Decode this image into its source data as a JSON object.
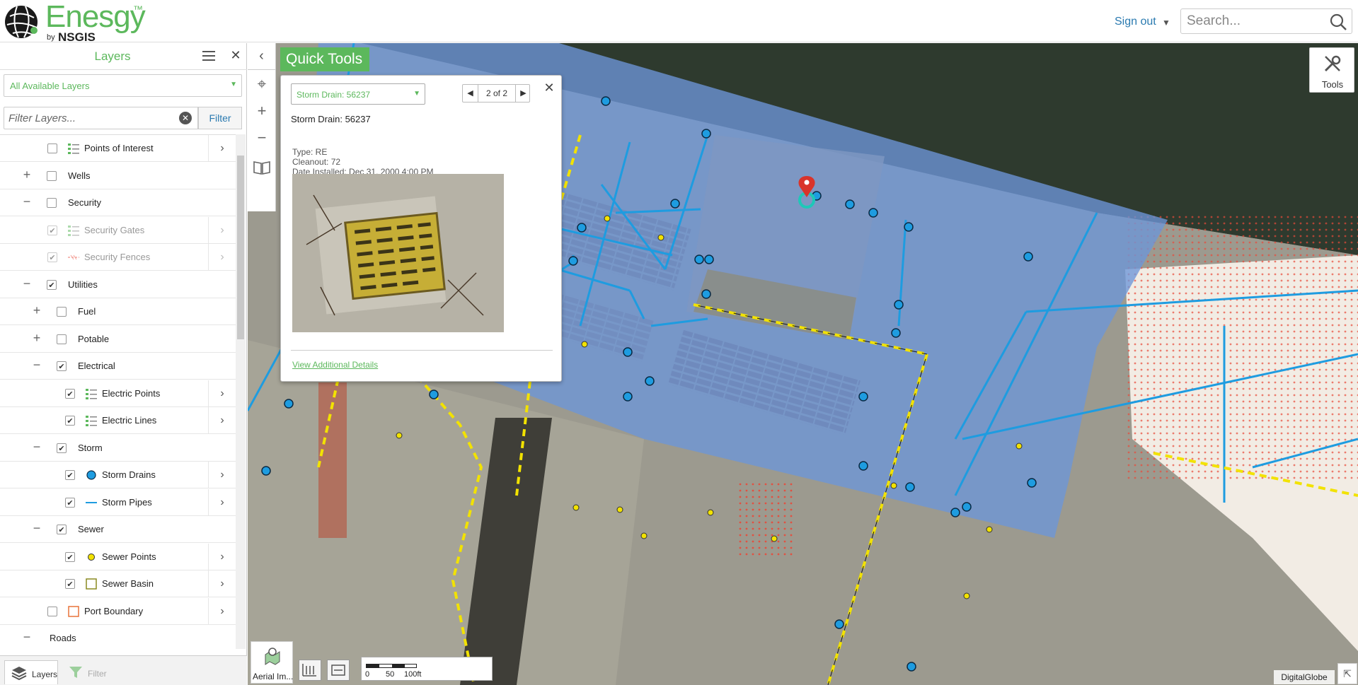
{
  "header": {
    "brand": "Enesgy",
    "trademark": "™",
    "by": "by",
    "company": "NSGIS",
    "sign_out": "Sign out",
    "search_placeholder": "Search..."
  },
  "sidebar": {
    "title": "Layers",
    "layer_select": "All Available Layers",
    "filter_placeholder": "Filter Layers...",
    "filter_button": "Filter",
    "tree": [
      {
        "label": "Points of Interest",
        "checked": false,
        "expander": "",
        "symbol": "legend-list",
        "sub": true
      },
      {
        "label": "Wells",
        "checked": false,
        "expander": "+",
        "symbol": "",
        "sub": false
      },
      {
        "label": "Security",
        "checked": false,
        "expander": "—",
        "symbol": "",
        "sub": false
      },
      {
        "label": "Security Gates",
        "checked": true,
        "expander": "",
        "symbol": "legend-list",
        "sub": true,
        "dim": true
      },
      {
        "label": "Security Fences",
        "checked": true,
        "expander": "",
        "symbol": "fence-line",
        "sub": true,
        "dim": true
      },
      {
        "label": "Utilities",
        "checked": true,
        "expander": "—",
        "symbol": "",
        "sub": false
      },
      {
        "label": "Fuel",
        "checked": false,
        "expander": "+",
        "symbol": "",
        "sub": false,
        "level": 1
      },
      {
        "label": "Potable",
        "checked": false,
        "expander": "+",
        "symbol": "",
        "sub": false,
        "level": 1
      },
      {
        "label": "Electrical",
        "checked": true,
        "expander": "—",
        "symbol": "",
        "sub": false,
        "level": 1
      },
      {
        "label": "Electric Points",
        "checked": true,
        "expander": "",
        "symbol": "legend-list",
        "sub": true,
        "level": 1
      },
      {
        "label": "Electric Lines",
        "checked": true,
        "expander": "",
        "symbol": "legend-list",
        "sub": true,
        "level": 1
      },
      {
        "label": "Storm",
        "checked": true,
        "expander": "—",
        "symbol": "",
        "sub": false,
        "level": 1
      },
      {
        "label": "Storm Drains",
        "checked": true,
        "expander": "",
        "symbol": "blue-dot",
        "sub": true,
        "level": 1
      },
      {
        "label": "Storm Pipes",
        "checked": true,
        "expander": "",
        "symbol": "blue-line",
        "sub": true,
        "level": 1
      },
      {
        "label": "Sewer",
        "checked": true,
        "expander": "—",
        "symbol": "",
        "sub": false,
        "level": 1
      },
      {
        "label": "Sewer Points",
        "checked": true,
        "expander": "",
        "symbol": "yellow-dot",
        "sub": true,
        "level": 1
      },
      {
        "label": "Sewer Basin",
        "checked": true,
        "expander": "",
        "symbol": "olive-square",
        "sub": true,
        "level": 1
      },
      {
        "label": "Port Boundary",
        "checked": false,
        "expander": "",
        "symbol": "orange-square",
        "sub": true
      },
      {
        "label": "Roads",
        "checked": false,
        "expander": "—",
        "symbol": "",
        "sub": false,
        "level": -1
      }
    ],
    "tabs": {
      "layers": "Layers",
      "filter": "Filter"
    }
  },
  "map": {
    "quick_tools": "Quick Tools",
    "tools_label": "Tools",
    "basemap_label": "Aerial Im...",
    "scale_labels": [
      "0",
      "50",
      "100ft"
    ],
    "attribution": "DigitalGlobe",
    "popup": {
      "select_value": "Storm Drain: 56237",
      "pager": "2 of 2",
      "title": "Storm Drain: 56237",
      "type": "Type: RE",
      "cleanout": "Cleanout: 72",
      "date_installed": "Date Installed: Dec 31, 2000 4:00 PM",
      "link": "View Additional Details"
    }
  },
  "colors": {
    "brand_green": "#5cb85c",
    "link_blue": "#2a7ab0",
    "storm_blue": "#1e9ce0",
    "sewer_yellow": "#f2e200",
    "boundary_red": "#e84a3a"
  }
}
